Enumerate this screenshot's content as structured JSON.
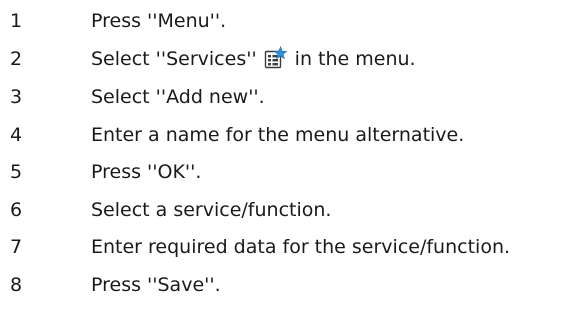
{
  "steps": [
    {
      "number": "1",
      "text": "Press ''Menu''."
    },
    {
      "number": "2",
      "text_before_icon": "Select ''Services''",
      "icon": "services-icon",
      "text_after_icon": "in the menu."
    },
    {
      "number": "3",
      "text": "Select ''Add new''."
    },
    {
      "number": "4",
      "text": "Enter a name for the menu alternative."
    },
    {
      "number": "5",
      "text": "Press ''OK''."
    },
    {
      "number": "6",
      "text": "Select a service/function."
    },
    {
      "number": "7",
      "text": "Enter required data for the service/function."
    },
    {
      "number": "8",
      "text": "Press ''Save''."
    }
  ],
  "colors": {
    "text": "#1a1a1a",
    "icon_frame": "#3c3c3c",
    "icon_star": "#2f8fd8"
  }
}
